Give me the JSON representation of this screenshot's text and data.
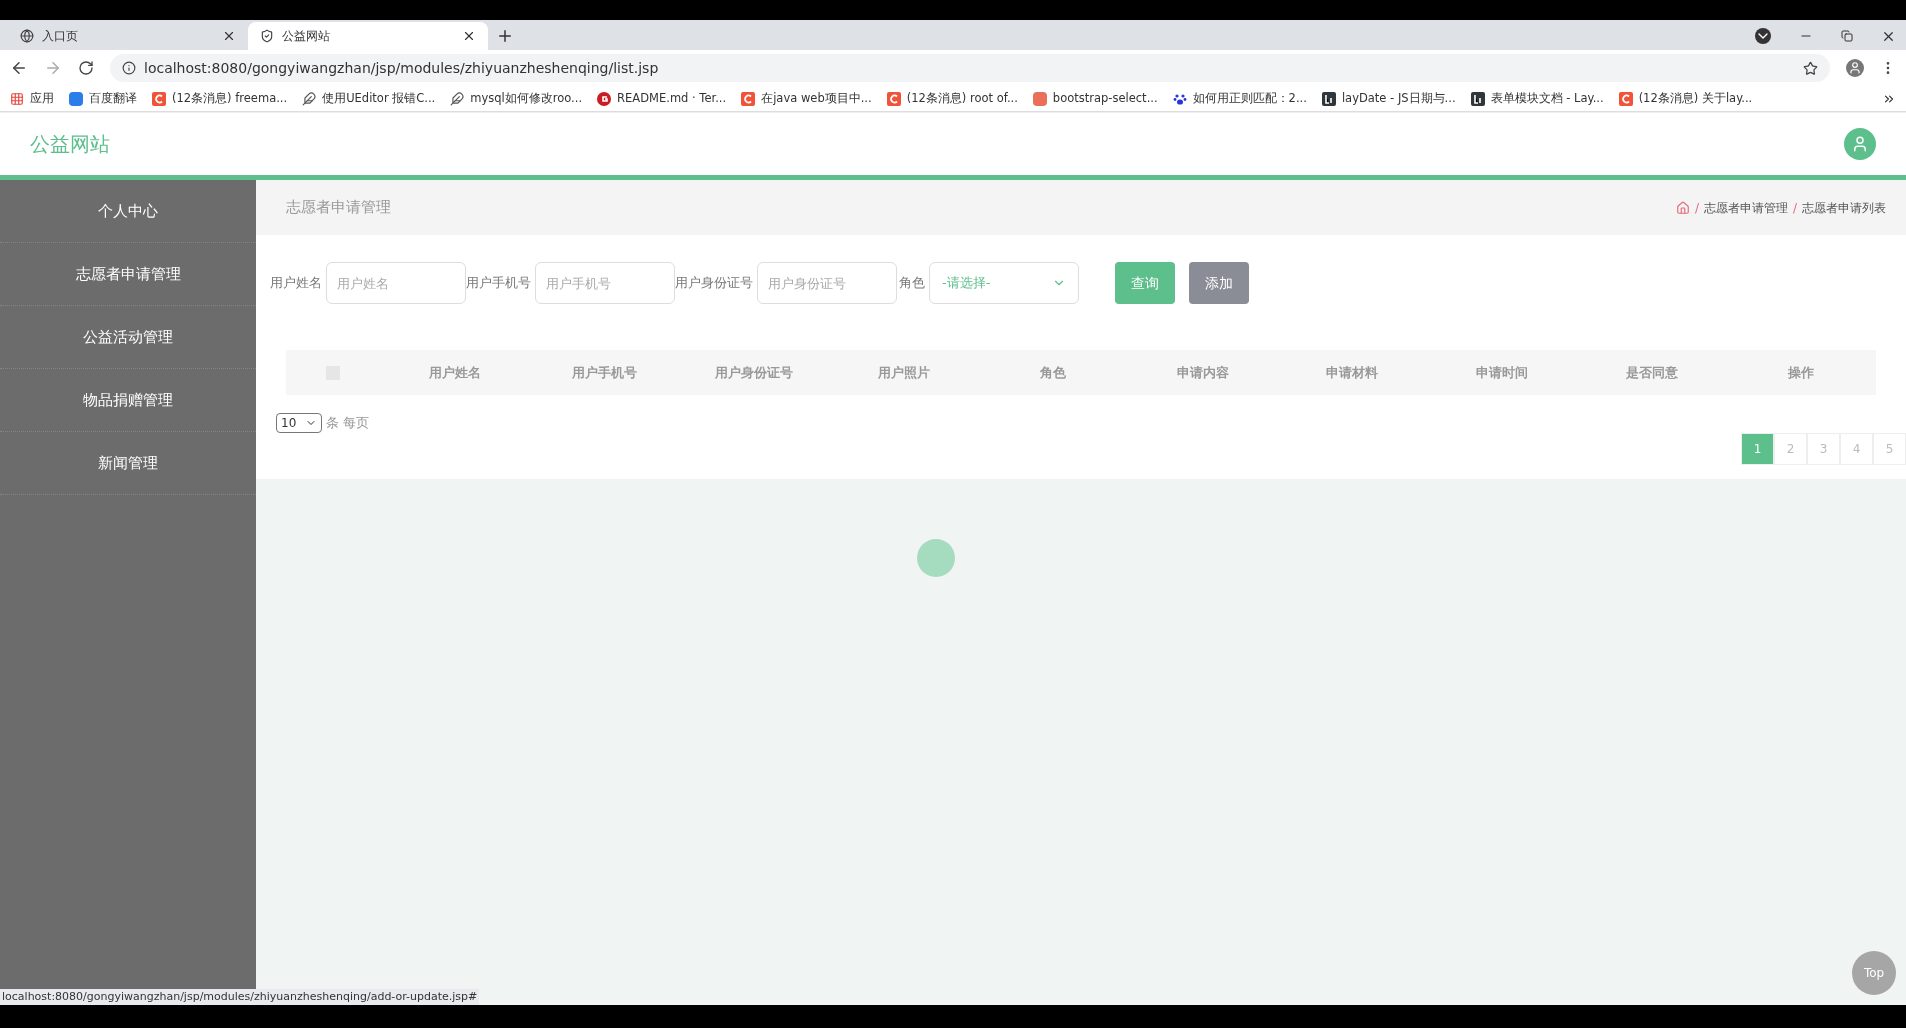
{
  "browser": {
    "tabs": [
      {
        "title": "入口页",
        "selected": false,
        "kind": "globe"
      },
      {
        "title": "公益网站",
        "selected": true,
        "kind": "shield"
      }
    ],
    "url": "localhost:8080/gongyiwangzhan/jsp/modules/zhiyuanzheshenqing/list.jsp",
    "bookmarks": [
      {
        "label": "应用",
        "kind": "apps"
      },
      {
        "label": "百度翻译",
        "kind": "translate"
      },
      {
        "label": "(12条消息) freema...",
        "kind": "csdn"
      },
      {
        "label": "使用UEditor 报错C...",
        "kind": "feather"
      },
      {
        "label": "mysql如何修改roo...",
        "kind": "feather"
      },
      {
        "label": "README.md · Ter...",
        "kind": "gitee"
      },
      {
        "label": "在java web项目中...",
        "kind": "csdn"
      },
      {
        "label": "(12条消息) root of...",
        "kind": "csdn"
      },
      {
        "label": "bootstrap-select...",
        "kind": "jianshu"
      },
      {
        "label": "如何用正则匹配：2...",
        "kind": "baidu"
      },
      {
        "label": "layDate - JS日期与...",
        "kind": "layui"
      },
      {
        "label": "表单模块文档 - Lay...",
        "kind": "layui"
      },
      {
        "label": "(12条消息) 关于lay...",
        "kind": "csdn"
      }
    ],
    "status_url": "localhost:8080/gongyiwangzhan/jsp/modules/zhiyuanzheshenqing/add-or-update.jsp#"
  },
  "site": {
    "title": "公益网站"
  },
  "sidebar": {
    "items": [
      "个人中心",
      "志愿者申请管理",
      "公益活动管理",
      "物品捐赠管理",
      "新闻管理"
    ]
  },
  "page_title": "志愿者申请管理",
  "breadcrumb": {
    "separator": "/",
    "items": [
      "志愿者申请管理",
      "志愿者申请列表"
    ]
  },
  "filters": [
    {
      "label": "用户姓名",
      "placeholder": "用户姓名"
    },
    {
      "label": "用户手机号",
      "placeholder": "用户手机号"
    },
    {
      "label": "用户身份证号",
      "placeholder": "用户身份证号"
    }
  ],
  "role_filter": {
    "label": "角色",
    "value": "-请选择-"
  },
  "buttons": [
    {
      "label": "查询",
      "kind": "primary"
    },
    {
      "label": "添加",
      "kind": "secondary"
    }
  ],
  "table": {
    "select_all_checked": false,
    "columns": [
      "用户姓名",
      "用户手机号",
      "用户身份证号",
      "用户照片",
      "角色",
      "申请内容",
      "申请材料",
      "申请时间",
      "是否同意",
      "操作"
    ]
  },
  "page_size": {
    "value": "10",
    "suffix": "条 每页"
  },
  "pages": [
    {
      "label": "1",
      "selected": true
    },
    {
      "label": "2",
      "selected": false
    },
    {
      "label": "3",
      "selected": false
    },
    {
      "label": "4",
      "selected": false
    },
    {
      "label": "5",
      "selected": false
    }
  ],
  "top_button": "Top"
}
